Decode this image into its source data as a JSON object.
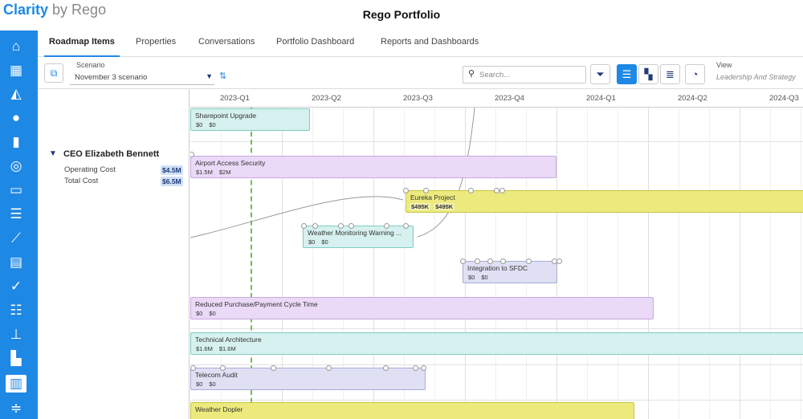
{
  "app": {
    "brand": "Clarity",
    "byline": " by Rego",
    "title": "Rego Portfolio"
  },
  "tabs": [
    {
      "label": "Roadmap Items",
      "active": true
    },
    {
      "label": "Properties"
    },
    {
      "label": "Conversations"
    },
    {
      "label": "Portfolio Dashboard"
    },
    {
      "label": "Reports and Dashboards"
    }
  ],
  "toolbar": {
    "scenario_label": "Scenario",
    "scenario_value": "November 3 scenario",
    "search_placeholder": "Search...",
    "view_label": "View",
    "view_value": "Leadership And Strategy"
  },
  "group": {
    "name": "CEO Elizabeth Bennett",
    "metrics": [
      {
        "label": "Operating Cost",
        "value": "$4.5M"
      },
      {
        "label": "Total Cost",
        "value": "$6.5M"
      }
    ]
  },
  "timeline": {
    "quarters": [
      "2023-Q1",
      "2023-Q2",
      "2023-Q3",
      "2023-Q4",
      "2024-Q1",
      "2024-Q2",
      "2024-Q3"
    ],
    "items": [
      {
        "name": "Sharepoint Upgrade",
        "amounts": [
          "$0",
          "$0"
        ],
        "color": "teal"
      },
      {
        "name": "Airport Access Security",
        "amounts": [
          "$1.5M",
          "$2M"
        ],
        "color": "purple"
      },
      {
        "name": "Eureka Project",
        "amounts": [
          "$495K",
          "$495K"
        ],
        "color": "yellow"
      },
      {
        "name": "Weather Monitoring Warning ...",
        "amounts": [
          "$0",
          "$0"
        ],
        "color": "teal"
      },
      {
        "name": "Integration to SFDC",
        "amounts": [
          "$0",
          "$0"
        ],
        "color": "lavender"
      },
      {
        "name": "Reduced Purchase/Payment Cycle Time",
        "amounts": [
          "$0",
          "$0"
        ],
        "color": "purple"
      },
      {
        "name": "Technical Architecture",
        "amounts": [
          "$1.6M",
          "$1.6M"
        ],
        "color": "teal"
      },
      {
        "name": "Telecom Audit",
        "amounts": [
          "$0",
          "$0"
        ],
        "color": "lavender"
      },
      {
        "name": "Weather Dopler",
        "amounts": [],
        "color": "yellow"
      }
    ]
  },
  "colors": {
    "accent": "#1e88e5",
    "today_line": "#6bbf4e"
  },
  "icons": {
    "rail": [
      "home-icon",
      "grid-icon",
      "area-chart-icon",
      "lightbulb-icon",
      "bar-chart-icon",
      "target-icon",
      "presentation-icon",
      "database-icon",
      "line-chart-icon",
      "clipboard-icon",
      "check-icon",
      "checklist-icon",
      "hierarchy-icon",
      "board-icon",
      "roadmap-icon",
      "sliders-icon"
    ]
  }
}
